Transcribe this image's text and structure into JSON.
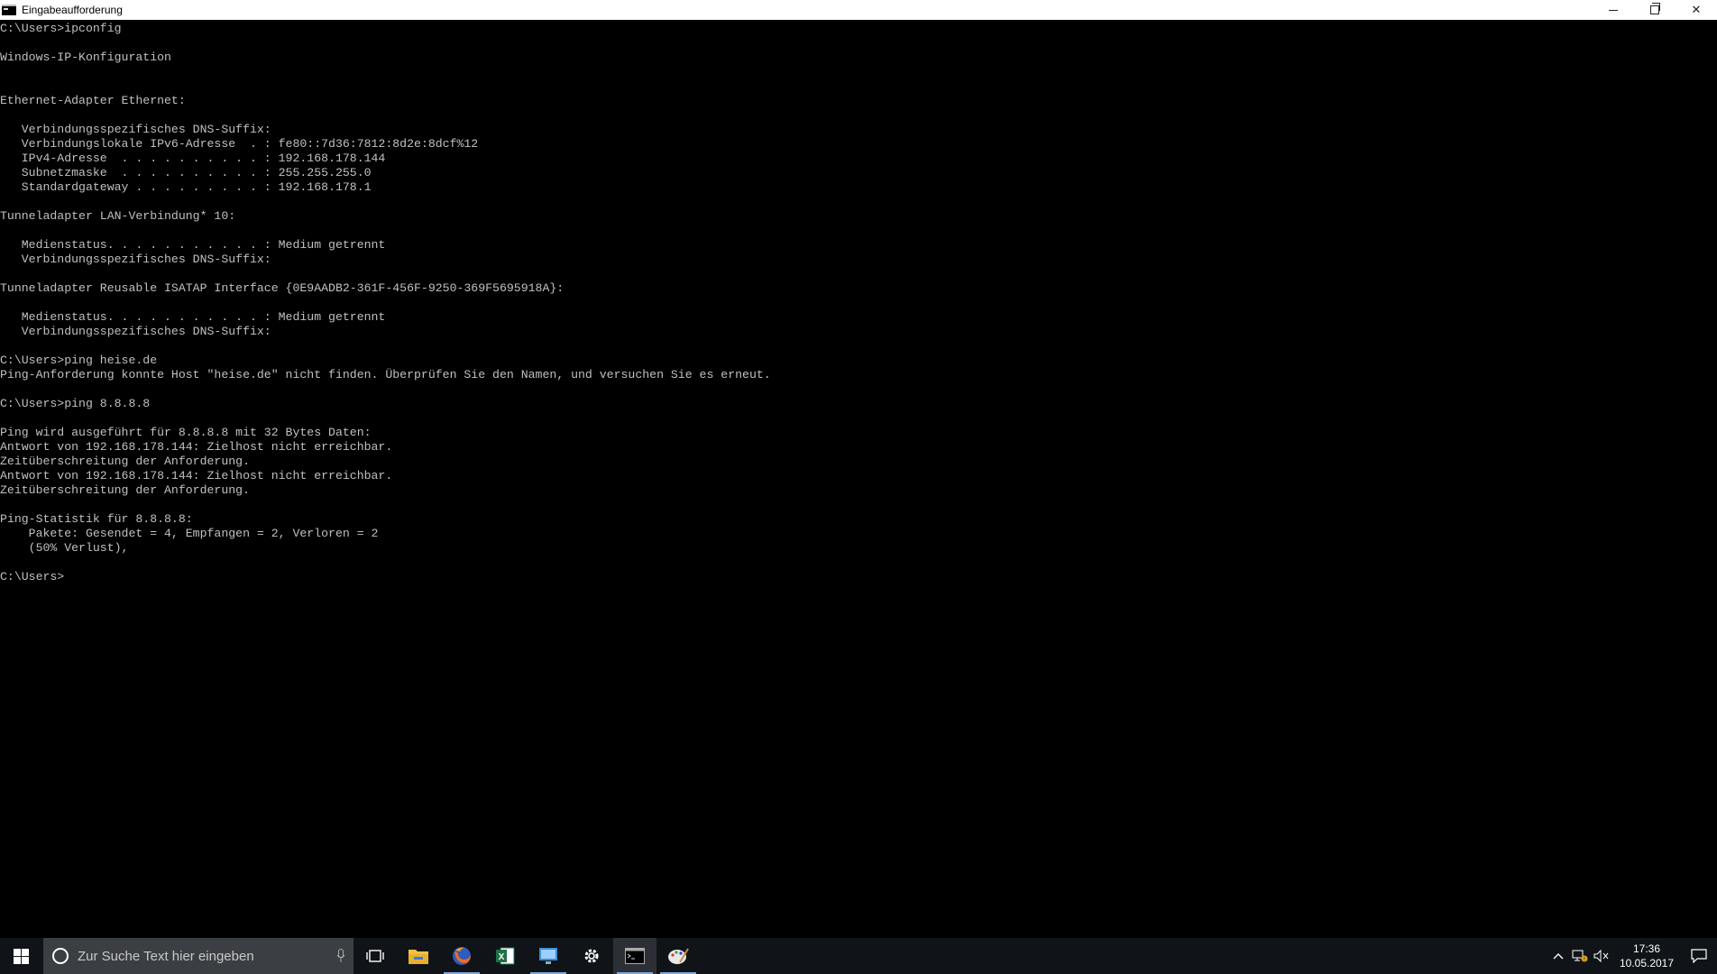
{
  "window": {
    "title": "Eingabeaufforderung",
    "minimize_label": "",
    "close_label": "✕"
  },
  "console": {
    "lines": [
      "C:\\Users>ipconfig",
      "",
      "Windows-IP-Konfiguration",
      "",
      "",
      "Ethernet-Adapter Ethernet:",
      "",
      "   Verbindungsspezifisches DNS-Suffix:",
      "   Verbindungslokale IPv6-Adresse  . : fe80::7d36:7812:8d2e:8dcf%12",
      "   IPv4-Adresse  . . . . . . . . . . : 192.168.178.144",
      "   Subnetzmaske  . . . . . . . . . . : 255.255.255.0",
      "   Standardgateway . . . . . . . . . : 192.168.178.1",
      "",
      "Tunneladapter LAN-Verbindung* 10:",
      "",
      "   Medienstatus. . . . . . . . . . . : Medium getrennt",
      "   Verbindungsspezifisches DNS-Suffix:",
      "",
      "Tunneladapter Reusable ISATAP Interface {0E9AADB2-361F-456F-9250-369F5695918A}:",
      "",
      "   Medienstatus. . . . . . . . . . . : Medium getrennt",
      "   Verbindungsspezifisches DNS-Suffix:",
      "",
      "C:\\Users>ping heise.de",
      "Ping-Anforderung konnte Host \"heise.de\" nicht finden. Überprüfen Sie den Namen, und versuchen Sie es erneut.",
      "",
      "C:\\Users>ping 8.8.8.8",
      "",
      "Ping wird ausgeführt für 8.8.8.8 mit 32 Bytes Daten:",
      "Antwort von 192.168.178.144: Zielhost nicht erreichbar.",
      "Zeitüberschreitung der Anforderung.",
      "Antwort von 192.168.178.144: Zielhost nicht erreichbar.",
      "Zeitüberschreitung der Anforderung.",
      "",
      "Ping-Statistik für 8.8.8.8:",
      "    Pakete: Gesendet = 4, Empfangen = 2, Verloren = 2",
      "    (50% Verlust),",
      "",
      "C:\\Users>"
    ]
  },
  "taskbar": {
    "search_placeholder": "Zur Suche Text hier eingeben",
    "apps": [
      {
        "name": "task-view-icon"
      },
      {
        "name": "file-explorer-icon"
      },
      {
        "name": "firefox-icon"
      },
      {
        "name": "excel-icon"
      },
      {
        "name": "remote-desktop-icon"
      },
      {
        "name": "settings-gear-icon"
      },
      {
        "name": "command-prompt-icon"
      },
      {
        "name": "paint-icon"
      }
    ],
    "clock_time": "17:36",
    "clock_date": "10.05.2017"
  },
  "colors": {
    "console_text": "#c0c0c0",
    "console_bg": "#000000",
    "taskbar_bg": "#101418"
  }
}
